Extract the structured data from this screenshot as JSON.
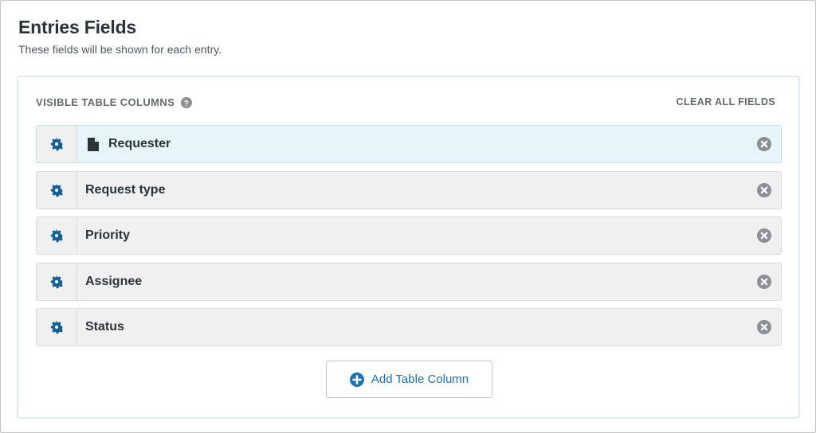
{
  "header": {
    "title": "Entries Fields",
    "subtitle": "These fields will be shown for each entry."
  },
  "panel": {
    "section_label": "VISIBLE TABLE COLUMNS",
    "clear_all_label": "CLEAR ALL FIELDS",
    "rows": [
      {
        "label": "Requester",
        "active": true,
        "icon": "document-icon"
      },
      {
        "label": "Request type",
        "active": false
      },
      {
        "label": "Priority",
        "active": false
      },
      {
        "label": "Assignee",
        "active": false
      },
      {
        "label": "Status",
        "active": false
      }
    ],
    "add_button_label": "Add Table Column"
  },
  "colors": {
    "accent": "#2271b1",
    "gear": "#135e96",
    "active_row": "#e5f5fa",
    "remove_icon": "#8c8f94"
  },
  "icons": {
    "row_settings": "gear-icon",
    "row_remove": "close-circle-icon",
    "help": "help-icon",
    "add": "plus-circle-icon"
  }
}
